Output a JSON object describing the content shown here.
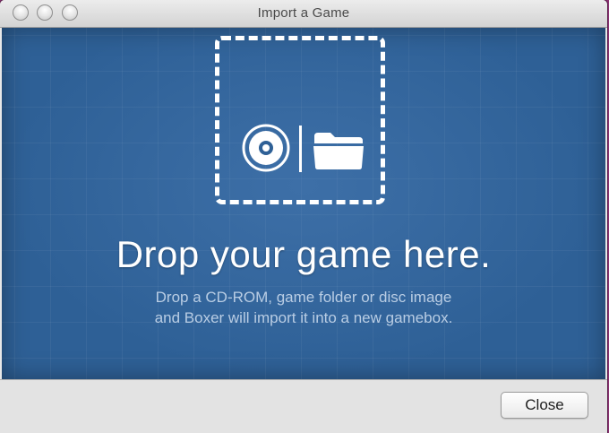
{
  "window": {
    "title": "Import a Game"
  },
  "dropzone": {
    "icons": [
      "cd-disc-icon",
      "folder-icon"
    ],
    "headline": "Drop your game here.",
    "subtext_line1": "Drop a CD-ROM, game folder or disc image",
    "subtext_line2": "and Boxer will import it into a new gamebox."
  },
  "footer": {
    "close_label": "Close"
  },
  "colors": {
    "panel_blue": "#2e6096",
    "icon_white": "#ffffff",
    "subtext": "#b9cde4"
  }
}
